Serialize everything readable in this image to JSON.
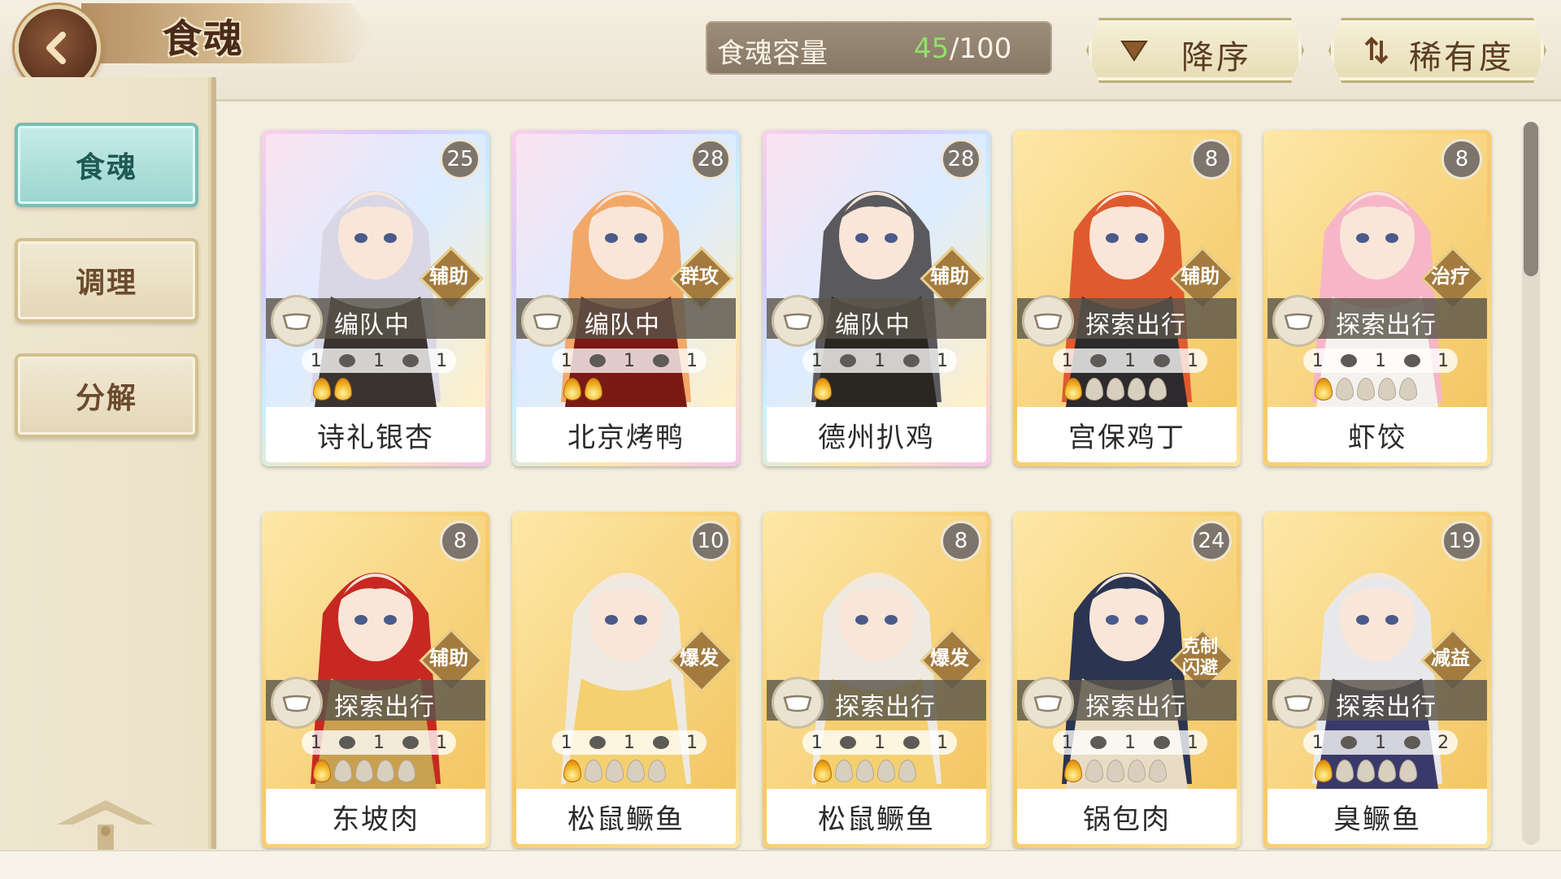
{
  "header": {
    "title": "食魂",
    "capacity": {
      "label": "食魂容量",
      "current": "45",
      "max": "/100"
    },
    "sort_order": {
      "label": "降序",
      "icon": "triangle-down-icon"
    },
    "sort_key": {
      "label": "稀有度",
      "icon": "sort-arrows-icon"
    }
  },
  "sidebar": {
    "items": [
      {
        "label": "食魂",
        "active": true
      },
      {
        "label": "调理",
        "active": false
      },
      {
        "label": "分解",
        "active": false
      }
    ]
  },
  "colors": {
    "accent_teal": "#9bd5cf",
    "capacity_green": "#8fe36a",
    "brown_text": "#5a3d22",
    "level_badge": "#7d756c"
  },
  "cards": [
    {
      "name": "诗礼银杏",
      "level": "25",
      "role": "辅助",
      "status": "编队中",
      "rarity": "rainbow",
      "stat1": "1",
      "stat2": "1",
      "stat3": "1",
      "flames": 2,
      "flames_total": 2
    },
    {
      "name": "北京烤鸭",
      "level": "28",
      "role": "群攻",
      "status": "编队中",
      "rarity": "rainbow",
      "stat1": "1",
      "stat2": "1",
      "stat3": "1",
      "flames": 2,
      "flames_total": 2
    },
    {
      "name": "德州扒鸡",
      "level": "28",
      "role": "辅助",
      "status": "编队中",
      "rarity": "rainbow",
      "stat1": "1",
      "stat2": "1",
      "stat3": "1",
      "flames": 1,
      "flames_total": 1
    },
    {
      "name": "宫保鸡丁",
      "level": "8",
      "role": "辅助",
      "status": "探索出行",
      "rarity": "gold",
      "stat1": "1",
      "stat2": "1",
      "stat3": "1",
      "flames": 1,
      "flames_total": 5
    },
    {
      "name": "虾饺",
      "level": "8",
      "role": "治疗",
      "status": "探索出行",
      "rarity": "gold",
      "stat1": "1",
      "stat2": "1",
      "stat3": "1",
      "flames": 1,
      "flames_total": 5
    },
    {
      "name": "东坡肉",
      "level": "8",
      "role": "辅助",
      "status": "探索出行",
      "rarity": "gold",
      "stat1": "1",
      "stat2": "1",
      "stat3": "1",
      "flames": 1,
      "flames_total": 5
    },
    {
      "name": "松鼠鳜鱼",
      "level": "10",
      "role": "爆发",
      "status": "",
      "rarity": "gold",
      "stat1": "1",
      "stat2": "1",
      "stat3": "1",
      "flames": 1,
      "flames_total": 5
    },
    {
      "name": "松鼠鳜鱼",
      "level": "8",
      "role": "爆发",
      "status": "探索出行",
      "rarity": "gold",
      "stat1": "1",
      "stat2": "1",
      "stat3": "1",
      "flames": 1,
      "flames_total": 5
    },
    {
      "name": "锅包肉",
      "level": "24",
      "role": "克制闪避",
      "status": "探索出行",
      "rarity": "gold",
      "stat1": "1",
      "stat2": "1",
      "stat3": "1",
      "flames": 1,
      "flames_total": 5
    },
    {
      "name": "臭鳜鱼",
      "level": "19",
      "role": "减益",
      "status": "探索出行",
      "rarity": "gold",
      "stat1": "1",
      "stat2": "1",
      "stat3": "2",
      "flames": 1,
      "flames_total": 5
    }
  ]
}
